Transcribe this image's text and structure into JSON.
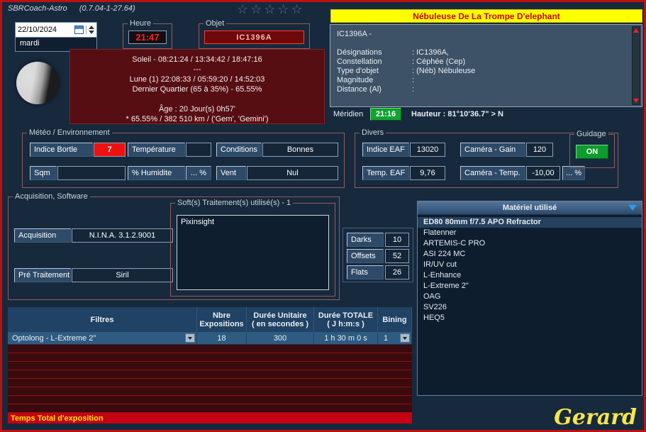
{
  "window": {
    "title": "SBRCoach-Astro",
    "version": "(0.7.04-1-27.64)"
  },
  "topbar": {
    "date_value": "22/10/2024",
    "day": "mardi",
    "stars": "☆☆☆☆☆",
    "heure": {
      "group_label": "Heure",
      "value": "21:47"
    },
    "objet": {
      "group_label": "Objet",
      "value": "IC1396A"
    }
  },
  "ephemeris": {
    "lines": [
      "Soleil - 08:21:24 / 13:34:42 / 18:47:16",
      "---",
      "Lune (1) 22:08:33 / 05:59:20 / 14:52:03",
      "Dernier Quartier (65 à 35%) - 65.55%",
      "Âge : 20 Jour(s) 0h57'",
      "* 65.55%  / 382 510 km / ('Gem', 'Gemini')"
    ]
  },
  "object_panel": {
    "title": "Nébuleuse De La Trompe D'elephant",
    "object_name": "IC1396A -",
    "fields": [
      {
        "label": "Désignations",
        "value": ": IC1396A,"
      },
      {
        "label": "Constellation",
        "value": ": Céphée (Cep)"
      },
      {
        "label": "Type d'objet",
        "value": ": (Néb) Nébuleuse"
      },
      {
        "label": "Magnitude",
        "value": ":"
      },
      {
        "label": "Distance (Al)",
        "value": ":"
      }
    ],
    "meridien": {
      "label": "Méridien",
      "time": "21:16",
      "hauteur": "Hauteur : 81°10'36.7\" > N"
    }
  },
  "meteo": {
    "group_label": "Météo / Environnement",
    "bortle": {
      "label": "Indice Bortle",
      "value": "7"
    },
    "temperature": {
      "label": "Température",
      "value": ""
    },
    "conditions": {
      "label": "Conditions",
      "value": "Bonnes"
    },
    "sqm": {
      "label": "Sqm",
      "value": ""
    },
    "humidite": {
      "label": "% Humidite",
      "button": "... %"
    },
    "vent": {
      "label": "Vent",
      "value": "Nul"
    }
  },
  "divers": {
    "group_label": "Divers",
    "indice_eaf": {
      "label": "Indice EAF",
      "value": "13020"
    },
    "camera_gain": {
      "label": "Caméra - Gain",
      "value": "120"
    },
    "temp_eaf": {
      "label": "Temp. EAF",
      "value": "9,76"
    },
    "camera_temp": {
      "label": "Caméra - Temp.",
      "value": "-10,00",
      "button": "... %"
    },
    "guidage": {
      "group_label": "Guidage",
      "state": "ON"
    }
  },
  "acquisition": {
    "group_label": "Acquisition, Software",
    "soft_group_label": "Soft(s) Traitement(s) utilisé(s) - 1",
    "soft_text": "Pixinsight",
    "acq": {
      "label": "Acquisition",
      "value": "N.I.N.A. 3.1.2.9001"
    },
    "pre": {
      "label": "Pré Traitement",
      "value": "Siril"
    }
  },
  "calibration": {
    "darks": {
      "label": "Darks",
      "value": "10"
    },
    "offsets": {
      "label": "Offsets",
      "value": "52"
    },
    "flats": {
      "label": "Flats",
      "value": "26"
    }
  },
  "materiel": {
    "header": "Matériel utilisé",
    "items": [
      "ED80 80mm f/7.5 APO Refractor",
      "Flatenner",
      "ARTEMIS-C PRO",
      "ASI 224 MC",
      "IR/UV cut",
      "L-Enhance",
      "L-Extreme 2\"",
      "OAG",
      "SV226",
      "HEQ5"
    ]
  },
  "filters_table": {
    "headers": [
      {
        "l1": "Filtres",
        "l2": ""
      },
      {
        "l1": "Nbre",
        "l2": "Expositions"
      },
      {
        "l1": "Durée Unitaire",
        "l2": "( en secondes )"
      },
      {
        "l1": "Durée TOTALE",
        "l2": "( J h:m:s )"
      },
      {
        "l1": "Bining",
        "l2": ""
      }
    ],
    "row": {
      "filtre": "Optolong - L-Extreme 2\"",
      "nbre": "18",
      "duree_unitaire": "300",
      "duree_totale": "1 h 30 m 0 s",
      "bining": "1"
    },
    "footer": "Temps Total d'exposition"
  },
  "colors": {
    "accent_red": "#c40000",
    "title_yellow": "#ffff00",
    "status_green": "#12a330",
    "bortle_red": "#ee1111"
  },
  "signature": "Gerard"
}
